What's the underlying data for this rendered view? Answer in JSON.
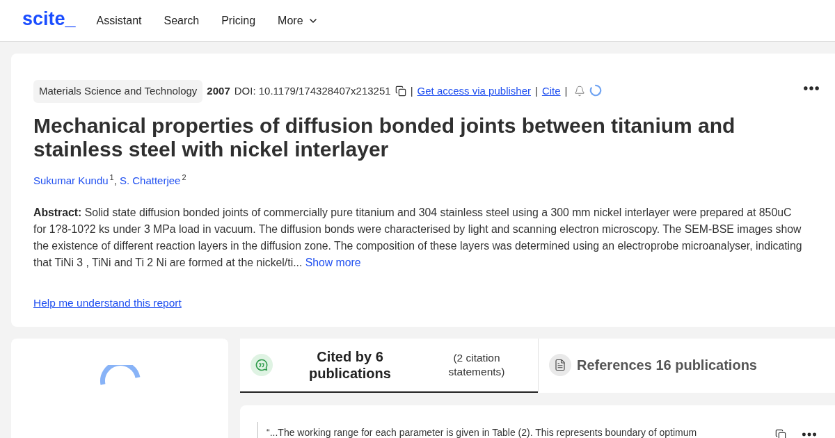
{
  "header": {
    "logo": "scite_",
    "nav": [
      {
        "label": "Assistant",
        "kind": "link"
      },
      {
        "label": "Search",
        "kind": "link"
      },
      {
        "label": "Pricing",
        "kind": "link"
      },
      {
        "label": "More",
        "kind": "dropdown"
      }
    ]
  },
  "paper": {
    "meta": [
      {
        "kind": "tag",
        "text": "Materials Science and Technology"
      },
      {
        "kind": "year",
        "text": "2007"
      },
      {
        "kind": "doi",
        "text": "DOI: 10.1179/174328407x213251"
      },
      {
        "kind": "copy"
      },
      {
        "kind": "separator",
        "text": "|"
      },
      {
        "kind": "link",
        "text": "Get access via publisher"
      },
      {
        "kind": "separator",
        "text": "|"
      },
      {
        "kind": "link",
        "text": "Cite"
      },
      {
        "kind": "separator",
        "text": "|"
      },
      {
        "kind": "bell"
      },
      {
        "kind": "loading"
      }
    ],
    "title": "Mechanical properties of diffusion bonded joints between titanium and stainless steel with nickel interlayer",
    "authors": [
      {
        "name": "Sukumar Kundu",
        "affiliation": "1"
      },
      {
        "name": "S. Chatterjee",
        "affiliation": "2"
      }
    ],
    "author_separator": ",",
    "abstract": {
      "label": "Abstract:",
      "text": "Solid state diffusion bonded joints of commercially pure titanium and 304 stainless steel using a 300 mm nickel interlayer were prepared at 850uC for 1?8-10?2 ks under 3 MPa load in vacuum. The diffusion bonds were characterised by light and scanning electron microscopy. The SEM-BSE images show the existence of different reaction layers in the diffusion zone. The composition of these layers was determined using an electroprobe microanalyser, indicating that TiNi 3 , TiNi and Ti 2 Ni are formed at the nickel/ti...",
      "more": "Show more"
    },
    "help_link": "Help me understand this report"
  },
  "tabs": [
    {
      "kind": "citing",
      "label": "Cited by 6 publications",
      "sublabel": "(2 citation statements)",
      "selected": true
    },
    {
      "kind": "references",
      "label": "References 16 publications",
      "selected": false
    }
  ],
  "citation": {
    "quote": "“...The working range for each parameter is given in Table (2). This represents boundary of optimum"
  }
}
